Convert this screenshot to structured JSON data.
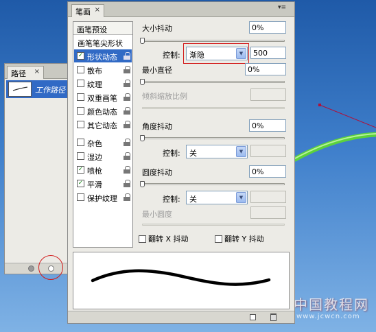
{
  "paths_panel": {
    "tab_label": "路径",
    "close_glyph": "×",
    "path_name": "工作路径"
  },
  "brush_panel": {
    "tab_label": "笔画",
    "close_glyph": "×",
    "menu_glyph": "▾≡",
    "list_header": "画笔预设",
    "items": [
      {
        "label": "画笔笔尖形状",
        "checkbox": false,
        "checked": false,
        "selected": false,
        "lock": false
      },
      {
        "label": "形状动态",
        "checkbox": true,
        "checked": true,
        "selected": true,
        "lock": true
      },
      {
        "label": "散布",
        "checkbox": true,
        "checked": false,
        "selected": false,
        "lock": true
      },
      {
        "label": "纹理",
        "checkbox": true,
        "checked": false,
        "selected": false,
        "lock": true
      },
      {
        "label": "双重画笔",
        "checkbox": true,
        "checked": false,
        "selected": false,
        "lock": true
      },
      {
        "label": "颜色动态",
        "checkbox": true,
        "checked": false,
        "selected": false,
        "lock": true
      },
      {
        "label": "其它动态",
        "checkbox": true,
        "checked": false,
        "selected": false,
        "lock": true
      },
      {
        "label": "杂色",
        "checkbox": true,
        "checked": false,
        "selected": false,
        "lock": true
      },
      {
        "label": "湿边",
        "checkbox": true,
        "checked": false,
        "selected": false,
        "lock": true
      },
      {
        "label": "喷枪",
        "checkbox": true,
        "checked": true,
        "selected": false,
        "lock": true
      },
      {
        "label": "平滑",
        "checkbox": true,
        "checked": true,
        "selected": false,
        "lock": true
      },
      {
        "label": "保护纹理",
        "checkbox": true,
        "checked": false,
        "selected": false,
        "lock": true
      }
    ],
    "check_glyph": "✓",
    "settings": {
      "size_jitter_label": "大小抖动",
      "size_jitter_value": "0%",
      "control_label": "控制:",
      "size_control_value": "渐隐",
      "size_fade_steps": "500",
      "min_diameter_label": "最小直径",
      "min_diameter_value": "0%",
      "tilt_scale_label": "倾斜缩放比例",
      "angle_jitter_label": "角度抖动",
      "angle_jitter_value": "0%",
      "angle_control_value": "关",
      "roundness_jitter_label": "圆度抖动",
      "roundness_jitter_value": "0%",
      "roundness_control_value": "关",
      "min_roundness_label": "最小圆度",
      "flip_x_label": "翻转 X 抖动",
      "flip_y_label": "翻转 Y 抖动"
    },
    "dropdown_arrow": "▼"
  },
  "watermark": {
    "text": "中国教程网",
    "url": "www.jcwcn.com"
  },
  "colors": {
    "selection": "#316ac5",
    "highlight_red": "#d21c1c",
    "panel_bg": "#ecebe6",
    "stroke_green": "#5cd23c",
    "path_line": "#b0103a"
  }
}
